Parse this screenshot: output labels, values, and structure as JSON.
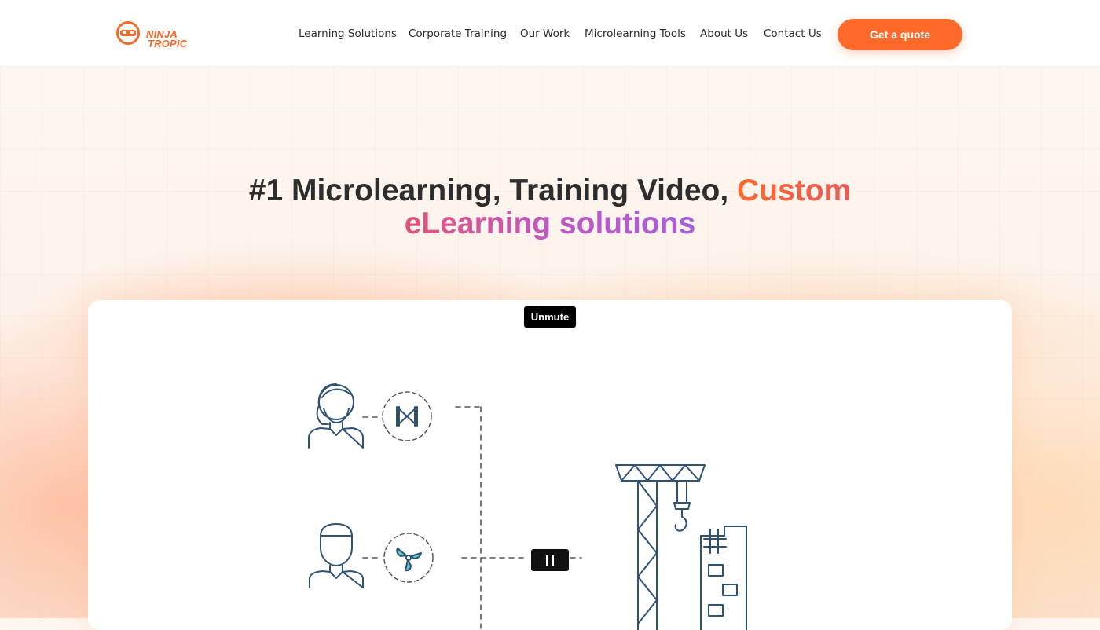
{
  "header": {
    "logo": {
      "line1": "NINJA",
      "line2": "TROPIC"
    },
    "nav": [
      {
        "label": "Learning Solutions"
      },
      {
        "label": "Corporate Training"
      },
      {
        "label": "Our Work"
      },
      {
        "label": "Microlearning Tools"
      },
      {
        "label": "About Us"
      },
      {
        "label": "Contact Us"
      }
    ],
    "cta_label": "Get a quote"
  },
  "hero": {
    "headline_part1": "#1 Microlearning, Training Video,",
    "headline_part2": "Custom",
    "headline_part3": "eLearning solutions"
  },
  "video": {
    "unmute_label": "Unmute"
  },
  "colors": {
    "brand_orange": "#ff6a2b",
    "heading": "#2d2d2d",
    "illustration_stroke": "#2e5276",
    "illustration_accent": "#5fc8c0"
  }
}
